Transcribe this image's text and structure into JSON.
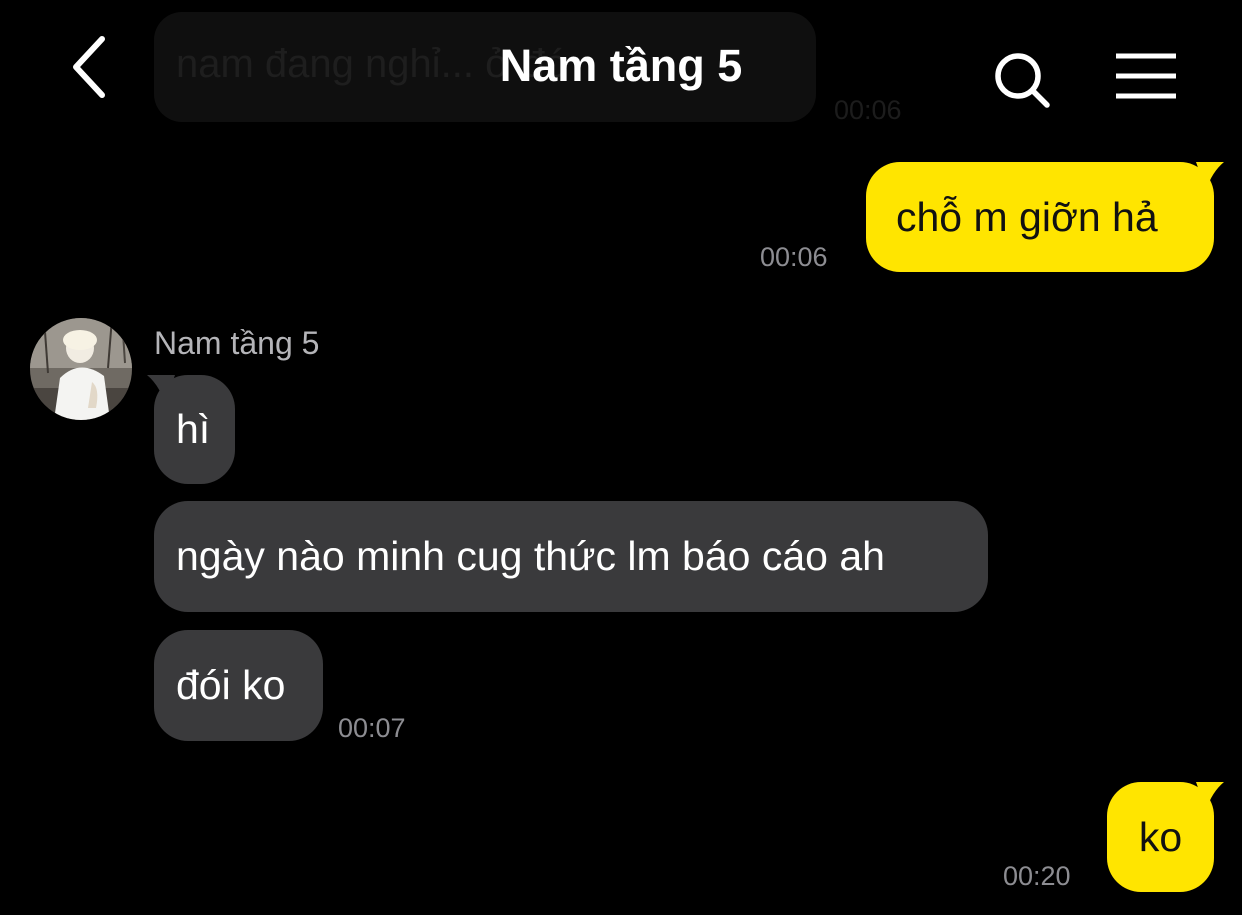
{
  "header": {
    "title": "Nam tầng 5",
    "back_icon": "chevron-left-icon",
    "search_icon": "search-icon",
    "menu_icon": "hamburger-menu-icon"
  },
  "colors": {
    "background": "#000000",
    "my_bubble": "#ffe500",
    "their_bubble": "#3a3a3c",
    "time_text": "#8d8d92"
  },
  "previous_message": {
    "text": "nam đang nghỉ... ở đó",
    "time": "00:06"
  },
  "messages": [
    {
      "from": "me",
      "text": "chỗ m giỡn hả",
      "time": "00:06"
    },
    {
      "from": "them",
      "sender": "Nam tầng 5",
      "text": "hì"
    },
    {
      "from": "them",
      "text": "ngày nào minh cug thức lm báo cáo ah"
    },
    {
      "from": "them",
      "text": "đói ko",
      "time": "00:07"
    },
    {
      "from": "me",
      "text": "ko",
      "time": "00:20"
    }
  ]
}
